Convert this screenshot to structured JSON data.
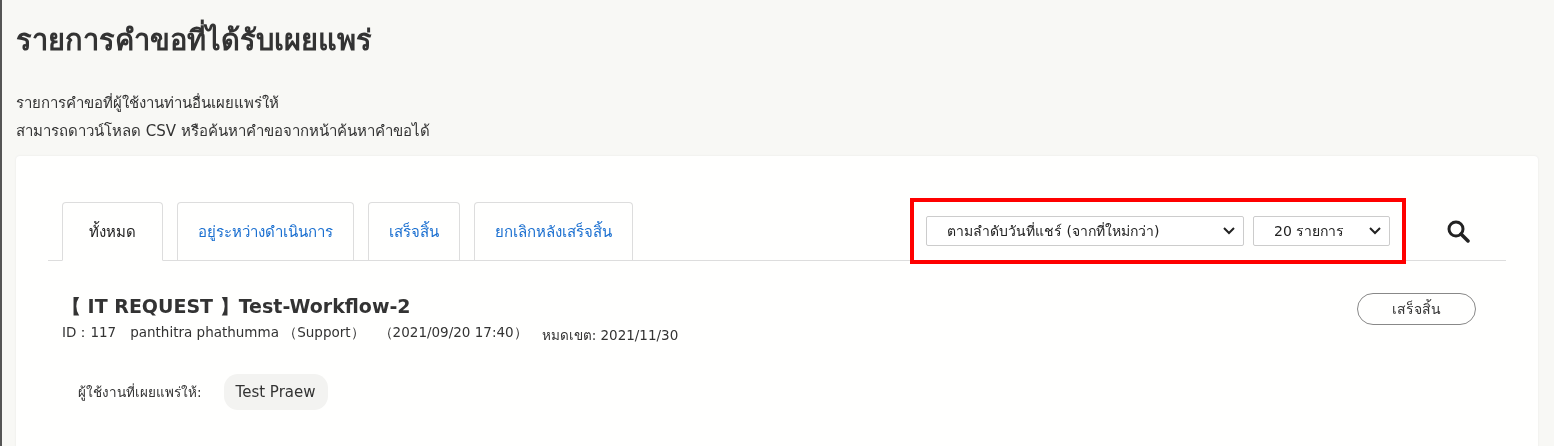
{
  "page": {
    "title": "รายการคำขอที่ได้รับเผยแพร่",
    "description": [
      "รายการคำขอที่ผู้ใช้งานท่านอื่นเผยแพร่ให้",
      "สามารถดาวน์โหลด CSV หรือค้นหาคำขอจากหน้าค้นหาคำขอได้"
    ]
  },
  "tabs": [
    {
      "label": "ทั้งหมด",
      "selected": true
    },
    {
      "label": "อยู่ระหว่างดำเนินการ",
      "selected": false
    },
    {
      "label": "เสร็จสิ้น",
      "selected": false
    },
    {
      "label": "ยกเลิกหลังเสร็จสิ้น",
      "selected": false
    }
  ],
  "filters": {
    "highlighted": true,
    "sort": "ตามลำดับวันที่แชร์ (จากที่ใหม่กว่า)",
    "per_page": "20 รายการ"
  },
  "requests": [
    {
      "title": "【 IT REQUEST 】Test-Workflow-2",
      "id": "ID：117",
      "requester": "panthitra phathumma （Support）",
      "shared_at": "（2021/09/20 17:40）",
      "deadline": "หมดเขต: 2021/11/30",
      "status": "เสร็จสิ้น",
      "shared_label": "ผู้ใช้งานที่เผยแพร่ให้:",
      "shared_with": [
        "Test Praew"
      ]
    }
  ]
}
